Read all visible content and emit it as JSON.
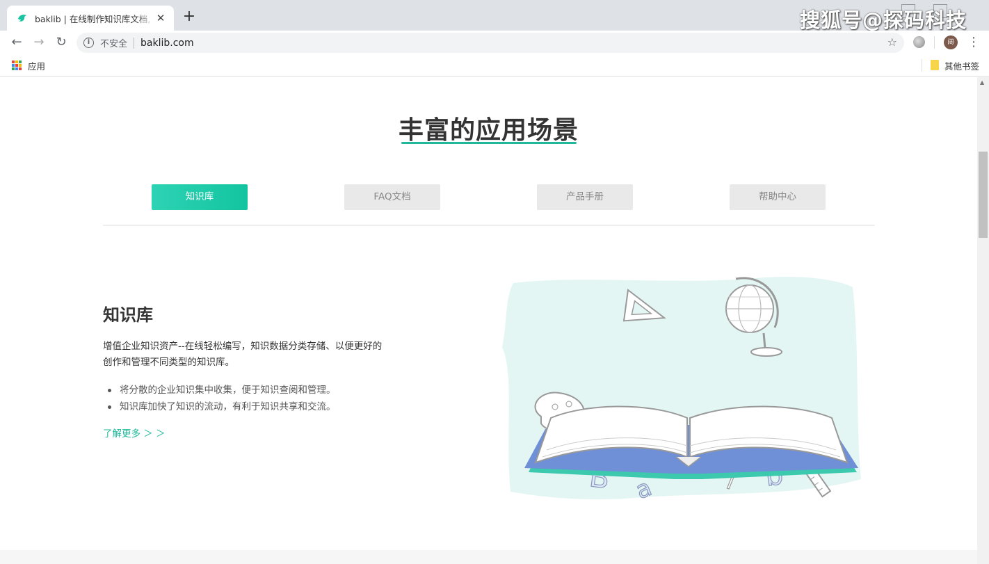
{
  "browser": {
    "tab_title": "baklib | 在线制作知识库文档, 帮",
    "tab_close": "✕",
    "new_tab": "+",
    "watermark": "搜狐号@探码科技",
    "security_label": "不安全",
    "url": "baklib.com",
    "avatar_initial": "阔",
    "bookmarks": {
      "apps_label": "应用",
      "other_label": "其他书签"
    }
  },
  "page": {
    "section_title": "丰富的应用场景",
    "tabs": [
      {
        "label": "知识库",
        "active": true
      },
      {
        "label": "FAQ文档",
        "active": false
      },
      {
        "label": "产品手册",
        "active": false
      },
      {
        "label": "帮助中心",
        "active": false
      }
    ],
    "content": {
      "title": "知识库",
      "description": "增值企业知识资产--在线轻松编写，知识数据分类存储、以便更好的创作和管理不同类型的知识库。",
      "bullets": [
        "将分散的企业知识集中收集，便于知识查阅和管理。",
        "知识库加快了知识的流动，有利于知识共享和交流。"
      ],
      "learn_more": "了解更多 ＞ ＞"
    },
    "illustration_letters": [
      "k",
      "l",
      "B",
      "a",
      "i",
      "b"
    ]
  },
  "colors": {
    "accent": "#1fb89a",
    "tab_inactive": "#e9e9e9",
    "illustration_bg": "#e3f6f3"
  }
}
